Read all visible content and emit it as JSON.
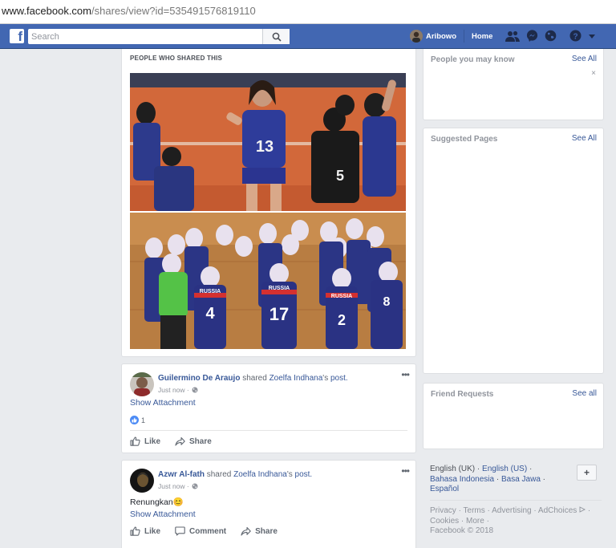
{
  "browser": {
    "url_host": "www.facebook.com",
    "url_path": "/shares/view?id=535491576819110"
  },
  "header": {
    "logo": "f",
    "search_placeholder": "Search",
    "user_name": "Aribowo",
    "home_label": "Home",
    "icons": [
      "friend-requests-icon",
      "messenger-icon",
      "notifications-globe-icon",
      "help-icon",
      "account-caret-icon"
    ],
    "brand_color": "#4267b2"
  },
  "shared": {
    "title": "PEOPLE WHO SHARED THIS",
    "photo_jerseys_top": [
      "13",
      "5"
    ],
    "photo_jerseys_bottom": [
      "RUSSIA",
      "4",
      "17",
      "2",
      "8"
    ]
  },
  "posts": [
    {
      "author": "Guilermino De Araujo",
      "verb": " shared ",
      "owner": "Zoelfa Indhana",
      "owner_suffix": "'s ",
      "object": "post.",
      "time": "Just now ·",
      "text": "",
      "attachment_link": "Show Attachment",
      "like_count": "1",
      "actions": [
        "Like",
        "Share"
      ]
    },
    {
      "author": "Azwr Al-fath",
      "verb": " shared ",
      "owner": "Zoelfa Indhana",
      "owner_suffix": "'s ",
      "object": "post.",
      "time": "Just now ·",
      "text": "Renungkan😊",
      "attachment_link": "Show Attachment",
      "actions": [
        "Like",
        "Comment",
        "Share"
      ]
    }
  ],
  "sidebar": {
    "pymk": {
      "title": "People you may know",
      "see_all": "See All",
      "close": "×"
    },
    "suggested": {
      "title": "Suggested Pages",
      "see_all": "See All"
    },
    "friend_requests": {
      "title": "Friend Requests",
      "see_all": "See all"
    },
    "languages": {
      "current": "English (UK)",
      "others": [
        "English (US)",
        "Bahasa Indonesia",
        "Basa Jawa",
        "Español"
      ],
      "add": "+"
    },
    "footer": {
      "links": [
        "Privacy",
        "Terms",
        "Advertising",
        "AdChoices",
        "Cookies",
        "More"
      ],
      "copyright": "Facebook © 2018"
    }
  }
}
